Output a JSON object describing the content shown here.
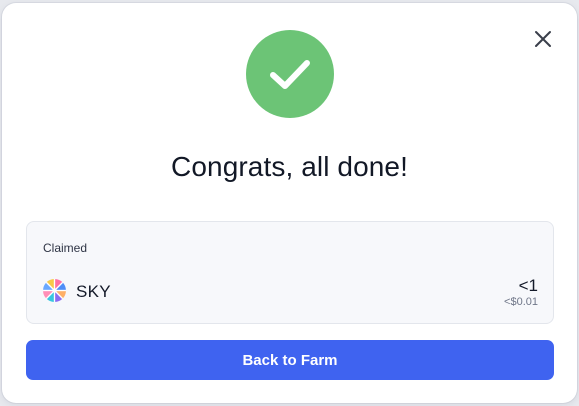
{
  "dialog": {
    "title": "Congrats, all done!",
    "close_icon": "close-icon",
    "success_icon": "checkmark-icon"
  },
  "claimed": {
    "label": "Claimed",
    "token": {
      "symbol": "SKY",
      "icon": "sky-token-icon",
      "amount": "<1",
      "usd_value": "<$0.01"
    }
  },
  "actions": {
    "primary_label": "Back to Farm"
  },
  "colors": {
    "success": "#6cc476",
    "primary": "#3f63f0",
    "card_background": "#f7f8fb"
  }
}
